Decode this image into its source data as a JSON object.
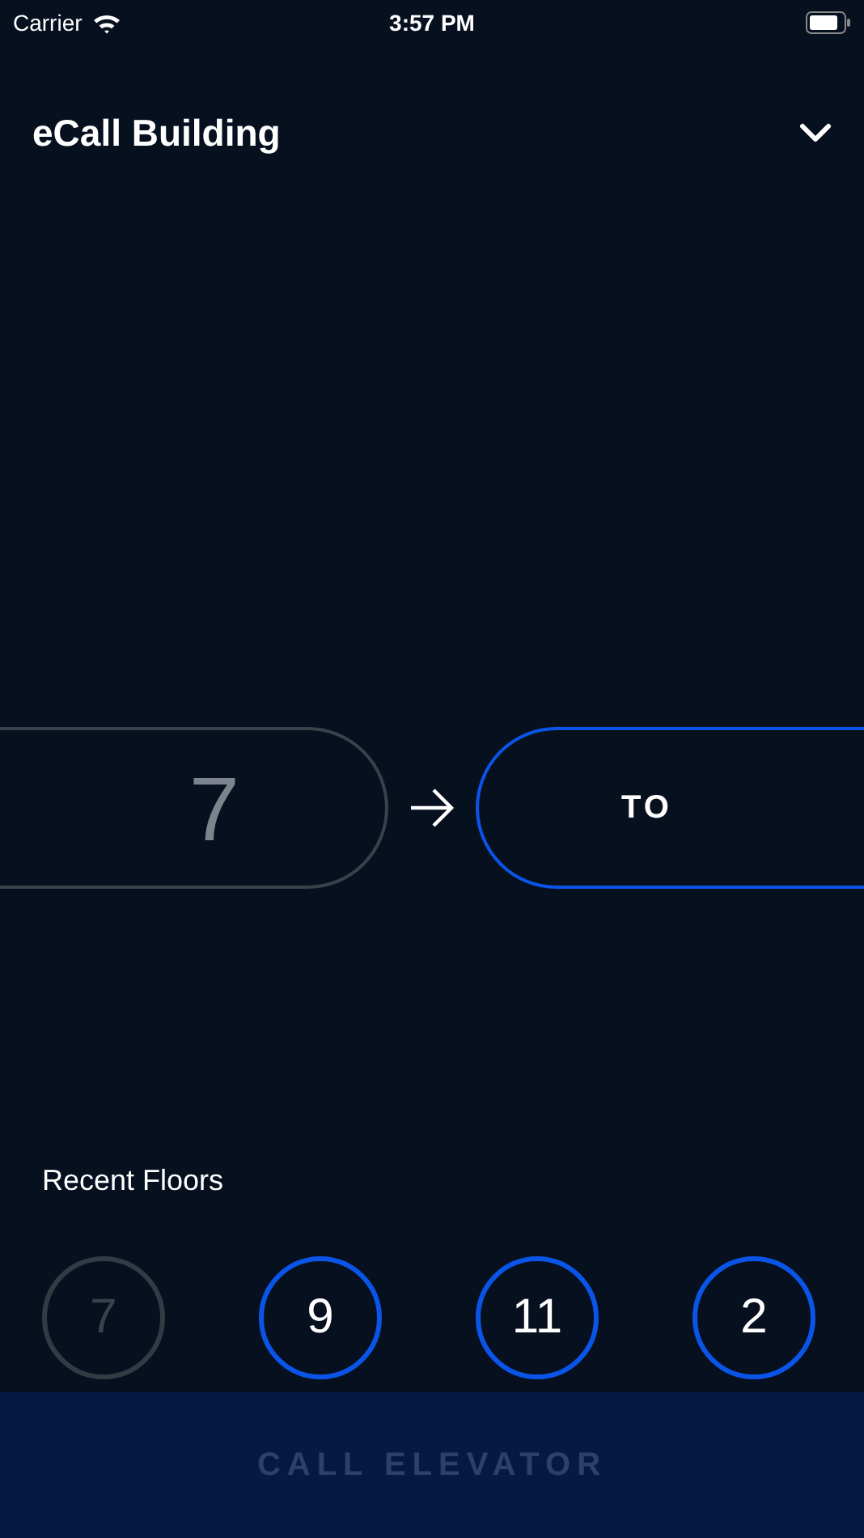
{
  "status_bar": {
    "carrier": "Carrier",
    "time": "3:57 PM"
  },
  "header": {
    "title": "eCall Building"
  },
  "route": {
    "from": {
      "value": "7",
      "selected": false
    },
    "to": {
      "placeholder": "TO",
      "selected": true
    }
  },
  "recent_floors": {
    "title": "Recent Floors",
    "floors": [
      {
        "label": "7",
        "disabled": true
      },
      {
        "label": "9",
        "disabled": false
      },
      {
        "label": "11",
        "disabled": false
      },
      {
        "label": "2",
        "disabled": false
      }
    ]
  },
  "call_button": {
    "label": "CALL ELEVATOR",
    "disabled": true
  }
}
